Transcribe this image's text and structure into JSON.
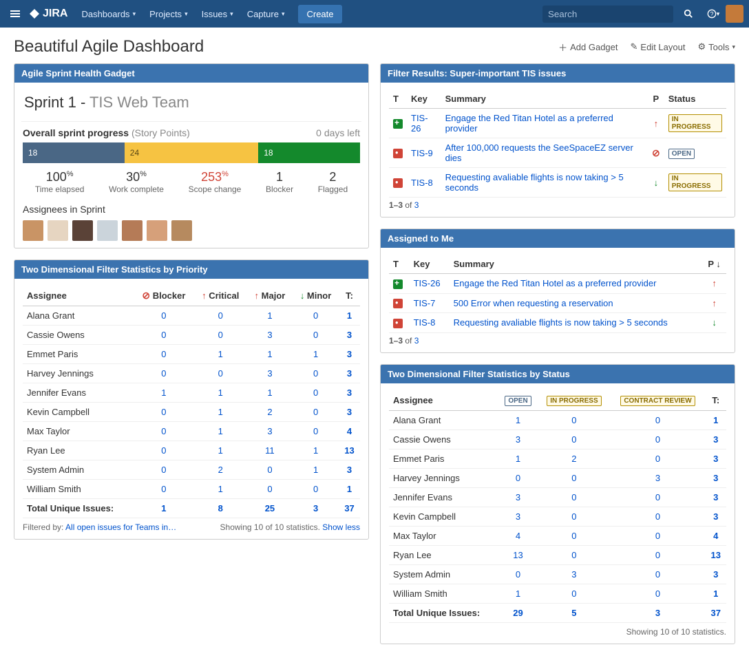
{
  "topbar": {
    "logo": "JIRA",
    "nav": [
      "Dashboards",
      "Projects",
      "Issues",
      "Capture"
    ],
    "create": "Create",
    "search_placeholder": "Search"
  },
  "page": {
    "title": "Beautiful Agile Dashboard",
    "add_gadget": "Add Gadget",
    "edit_layout": "Edit Layout",
    "tools": "Tools"
  },
  "sprint_health": {
    "gadget_title": "Agile Sprint Health Gadget",
    "sprint_name": "Sprint 1",
    "team": "TIS Web Team",
    "overall_label": "Overall sprint progress",
    "points_label": "(Story Points)",
    "days_left": "0 days left",
    "segs": {
      "todo": "18",
      "prog": "24",
      "done": "18"
    },
    "stats": [
      {
        "num": "100",
        "suffix": "%",
        "label": "Time elapsed"
      },
      {
        "num": "30",
        "suffix": "%",
        "label": "Work complete"
      },
      {
        "num": "253",
        "suffix": "%",
        "label": "Scope change",
        "red": true
      },
      {
        "num": "1",
        "suffix": "",
        "label": "Blocker"
      },
      {
        "num": "2",
        "suffix": "",
        "label": "Flagged"
      }
    ],
    "assignees_label": "Assignees in Sprint"
  },
  "filter_results": {
    "gadget_title": "Filter Results: Super-important TIS issues",
    "cols": {
      "t": "T",
      "key": "Key",
      "summary": "Summary",
      "p": "P",
      "status": "Status"
    },
    "rows": [
      {
        "type": "story",
        "key": "TIS-26",
        "summary": "Engage the Red Titan Hotel as a preferred provider",
        "prio": "up",
        "status": "IN PROGRESS",
        "status_cls": "lz-prog"
      },
      {
        "type": "bug",
        "key": "TIS-9",
        "summary": "After 100,000 requests the SeeSpaceEZ server dies",
        "prio": "block",
        "status": "OPEN",
        "status_cls": "lz-open"
      },
      {
        "type": "bug",
        "key": "TIS-8",
        "summary": "Requesting avaliable flights is now taking > 5 seconds",
        "prio": "down",
        "status": "IN PROGRESS",
        "status_cls": "lz-prog"
      }
    ],
    "pager": {
      "range": "1–3",
      "of": "of",
      "total": "3"
    }
  },
  "assigned": {
    "gadget_title": "Assigned to Me",
    "cols": {
      "t": "T",
      "key": "Key",
      "summary": "Summary",
      "p": "P"
    },
    "rows": [
      {
        "type": "story",
        "key": "TIS-26",
        "summary": "Engage the Red Titan Hotel as a preferred provider",
        "prio": "up"
      },
      {
        "type": "bug",
        "key": "TIS-7",
        "summary": "500 Error when requesting a reservation",
        "prio": "up"
      },
      {
        "type": "bug",
        "key": "TIS-8",
        "summary": "Requesting avaliable flights is now taking > 5 seconds",
        "prio": "down"
      }
    ],
    "pager": {
      "range": "1–3",
      "of": "of",
      "total": "3"
    }
  },
  "stats_priority": {
    "gadget_title": "Two Dimensional Filter Statistics by Priority",
    "assignee_hdr": "Assignee",
    "cols": [
      "Blocker",
      "Critical",
      "Major",
      "Minor"
    ],
    "col_prio": [
      "block",
      "up",
      "up",
      "down"
    ],
    "t_hdr": "T:",
    "rows": [
      {
        "name": "Alana Grant",
        "v": [
          0,
          0,
          1,
          0
        ],
        "t": 1
      },
      {
        "name": "Cassie Owens",
        "v": [
          0,
          0,
          3,
          0
        ],
        "t": 3
      },
      {
        "name": "Emmet Paris",
        "v": [
          0,
          1,
          1,
          1
        ],
        "t": 3
      },
      {
        "name": "Harvey Jennings",
        "v": [
          0,
          0,
          3,
          0
        ],
        "t": 3
      },
      {
        "name": "Jennifer Evans",
        "v": [
          1,
          1,
          1,
          0
        ],
        "t": 3
      },
      {
        "name": "Kevin Campbell",
        "v": [
          0,
          1,
          2,
          0
        ],
        "t": 3
      },
      {
        "name": "Max Taylor",
        "v": [
          0,
          1,
          3,
          0
        ],
        "t": 4
      },
      {
        "name": "Ryan Lee",
        "v": [
          0,
          1,
          11,
          1
        ],
        "t": 13
      },
      {
        "name": "System Admin",
        "v": [
          0,
          2,
          0,
          1
        ],
        "t": 3
      },
      {
        "name": "William Smith",
        "v": [
          0,
          1,
          0,
          0
        ],
        "t": 1
      }
    ],
    "total_label": "Total Unique Issues:",
    "totals": [
      1,
      8,
      25,
      3
    ],
    "grand_total": 37,
    "footer_label": "Filtered by:",
    "footer_link": "All open issues for Teams in…",
    "showing": "Showing 10 of 10 statistics.",
    "show_less": "Show less"
  },
  "stats_status": {
    "gadget_title": "Two Dimensional Filter Statistics by Status",
    "assignee_hdr": "Assignee",
    "cols": [
      "OPEN",
      "IN PROGRESS",
      "CONTRACT REVIEW"
    ],
    "col_cls": [
      "lz-open",
      "lz-prog",
      "lz-contract"
    ],
    "t_hdr": "T:",
    "rows": [
      {
        "name": "Alana Grant",
        "v": [
          1,
          0,
          0
        ],
        "t": 1
      },
      {
        "name": "Cassie Owens",
        "v": [
          3,
          0,
          0
        ],
        "t": 3
      },
      {
        "name": "Emmet Paris",
        "v": [
          1,
          2,
          0
        ],
        "t": 3
      },
      {
        "name": "Harvey Jennings",
        "v": [
          0,
          0,
          3
        ],
        "t": 3
      },
      {
        "name": "Jennifer Evans",
        "v": [
          3,
          0,
          0
        ],
        "t": 3
      },
      {
        "name": "Kevin Campbell",
        "v": [
          3,
          0,
          0
        ],
        "t": 3
      },
      {
        "name": "Max Taylor",
        "v": [
          4,
          0,
          0
        ],
        "t": 4
      },
      {
        "name": "Ryan Lee",
        "v": [
          13,
          0,
          0
        ],
        "t": 13
      },
      {
        "name": "System Admin",
        "v": [
          0,
          3,
          0
        ],
        "t": 3
      },
      {
        "name": "William Smith",
        "v": [
          1,
          0,
          0
        ],
        "t": 1
      }
    ],
    "total_label": "Total Unique Issues:",
    "totals": [
      29,
      5,
      3
    ],
    "grand_total": 37,
    "showing": "Showing 10 of 10 statistics."
  }
}
